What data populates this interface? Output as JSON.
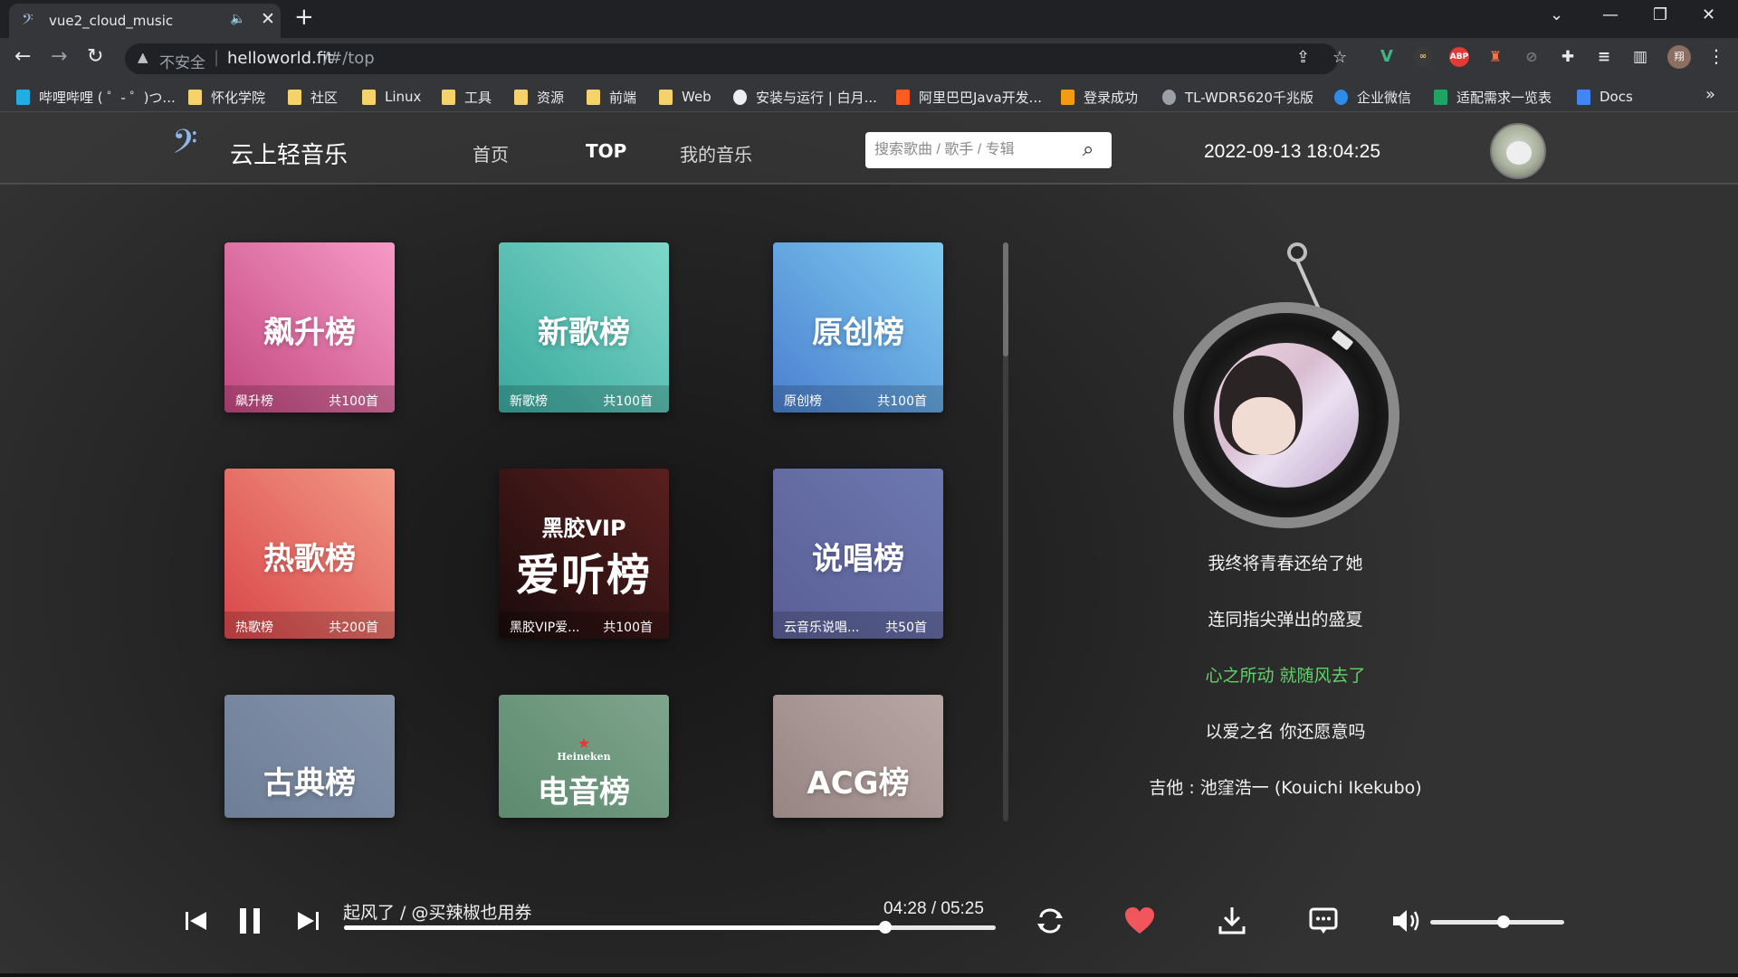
{
  "browser": {
    "tab_title": "vue2_cloud_music",
    "insecure_label": "不安全",
    "url_host": "helloworld.fit",
    "url_path": "/#/top",
    "bookmarks": [
      {
        "label": "哔哩哔哩 ( ゜- ゜)つ..."
      },
      {
        "label": "怀化学院"
      },
      {
        "label": "社区"
      },
      {
        "label": "Linux"
      },
      {
        "label": "工具"
      },
      {
        "label": "资源"
      },
      {
        "label": "前端"
      },
      {
        "label": "Web"
      },
      {
        "label": "安装与运行 | 白月..."
      },
      {
        "label": "阿里巴巴Java开发..."
      },
      {
        "label": "登录成功"
      },
      {
        "label": "TL-WDR5620千兆版"
      },
      {
        "label": "企业微信"
      },
      {
        "label": "适配需求一览表"
      },
      {
        "label": "Docs"
      }
    ],
    "profile_initial": "翔"
  },
  "app": {
    "logo_text": "云上轻音乐",
    "nav": [
      "首页",
      "TOP",
      "我的音乐"
    ],
    "search_placeholder": "搜索歌曲 / 歌手 / 专辑",
    "datetime": "2022-09-13 18:04:25"
  },
  "charts": [
    {
      "title": "飙升榜",
      "name": "飙升榜",
      "count": "共100首",
      "color_from": "#f79ac7",
      "color_to": "#c2477f"
    },
    {
      "title": "新歌榜",
      "name": "新歌榜",
      "count": "共100首",
      "color_from": "#7ed8c9",
      "color_to": "#3aa89d"
    },
    {
      "title": "原创榜",
      "name": "原创榜",
      "count": "共100首",
      "color_from": "#7ecbf0",
      "color_to": "#4b7fcf"
    },
    {
      "title": "热歌榜",
      "name": "热歌榜",
      "count": "共200首",
      "color_from": "#f29a85",
      "color_to": "#d9464a"
    },
    {
      "title_top": "黑胶VIP",
      "title": "爱听榜",
      "name": "黑胶VIP爱...",
      "count": "共100首",
      "color_from": "#5a1f1f",
      "color_to": "#1a0b0b"
    },
    {
      "title": "说唱榜",
      "name": "云音乐说唱...",
      "count": "共50首",
      "color_from": "#6e78b0",
      "color_to": "#5a5f96"
    },
    {
      "title": "古典榜",
      "color_from": "#8493aa",
      "color_to": "#6f7e97"
    },
    {
      "brand": "Heineken",
      "title": "电音榜",
      "color_from": "#7fa58d",
      "color_to": "#5c8a6e"
    },
    {
      "title": "ACG榜",
      "color_from": "#b9a7a4",
      "color_to": "#968583"
    }
  ],
  "lyrics": [
    {
      "text": "我终将青春还给了她",
      "current": false
    },
    {
      "text": "连同指尖弹出的盛夏",
      "current": false
    },
    {
      "text": "心之所动 就随风去了",
      "current": true
    },
    {
      "text": "以爱之名 你还愿意吗",
      "current": false
    },
    {
      "text": "吉他 : 池窪浩一 (Kouichi Ikekubo)",
      "current": false
    }
  ],
  "player": {
    "track": "起风了 / @买辣椒也用券",
    "time": "04:28 / 05:25",
    "progress": 0.83,
    "volume": 0.55,
    "liked": true
  },
  "colors": {
    "accent_green": "#5fd36a",
    "like_red": "#f0565c"
  }
}
